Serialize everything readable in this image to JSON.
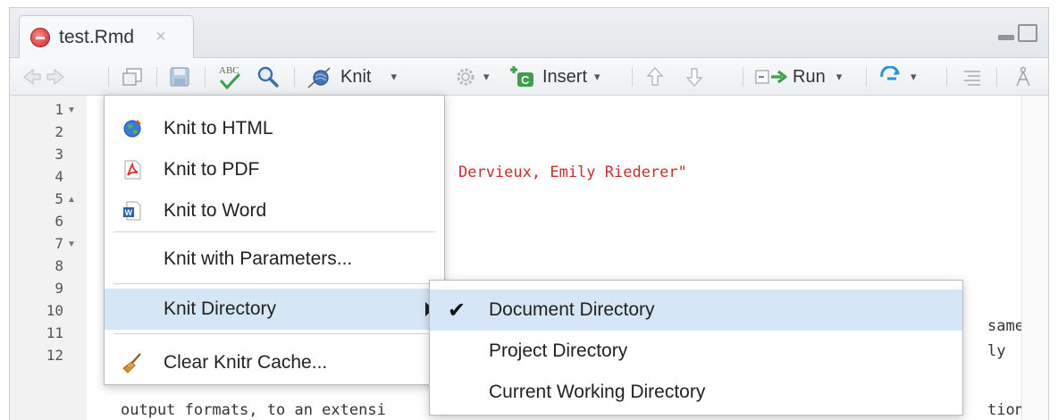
{
  "tab": {
    "title": "test.Rmd",
    "close": "×"
  },
  "toolbar": {
    "spell": "ABC",
    "knit_label": "Knit",
    "insert_label": "Insert",
    "insert_badge": "C",
    "run_label": "Run",
    "caret": "▾"
  },
  "gutter": {
    "lines": [
      "1",
      "2",
      "3",
      "4",
      "5",
      "6",
      "7",
      "8",
      "9",
      "10",
      "11",
      "12"
    ]
  },
  "code": {
    "line3": "Dervieux, Emily Riederer\"",
    "line9": "same",
    "line10": "ly",
    "line12_left": "output formats, to an extensi",
    "line12_right": "tion"
  },
  "knit_menu": {
    "items": [
      {
        "label": "Knit to HTML"
      },
      {
        "label": "Knit to PDF"
      },
      {
        "label": "Knit to Word"
      },
      {
        "label": "Knit with Parameters..."
      },
      {
        "label": "Knit Directory"
      },
      {
        "label": "Clear Knitr Cache..."
      }
    ],
    "word_badge": "W"
  },
  "dir_menu": {
    "check": "✔",
    "items": [
      {
        "label": "Document Directory",
        "selected": true
      },
      {
        "label": "Project Directory"
      },
      {
        "label": "Current Working Directory"
      }
    ]
  },
  "colors": {
    "selected_bg": "#d5e6f6",
    "string_red": "#c4302b",
    "arrow_blue": "#2f8fd8",
    "green": "#3aa04a"
  }
}
